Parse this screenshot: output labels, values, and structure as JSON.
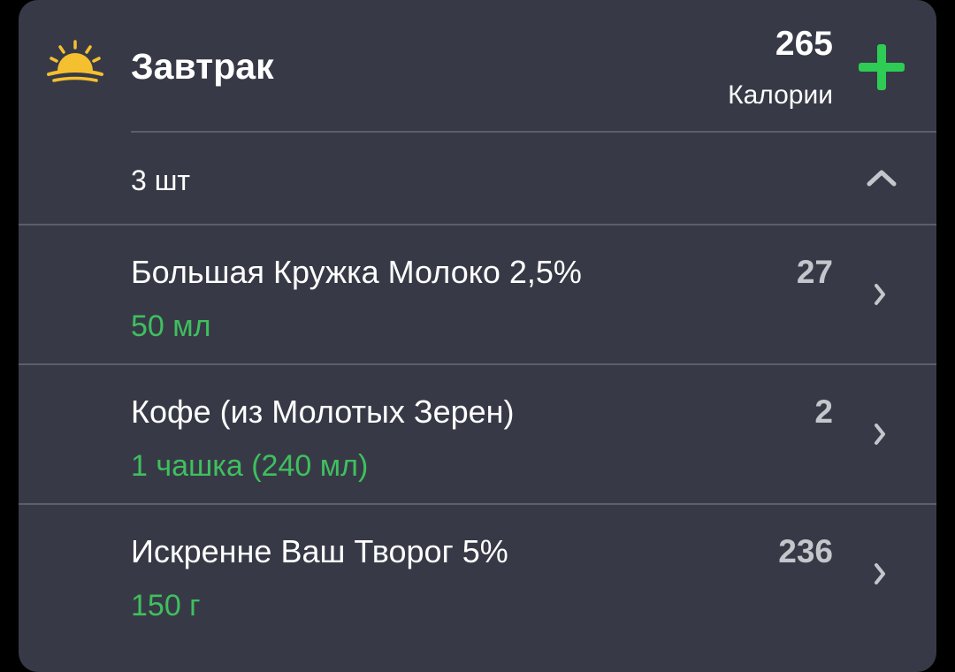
{
  "meal": {
    "title": "Завтрак",
    "icon": "sunrise-icon",
    "calories_value": "265",
    "calories_label": "Калории",
    "add_icon": "plus-icon"
  },
  "items_summary": {
    "count_label": "3 шт",
    "toggle_icon": "chevron-up-icon"
  },
  "foods": [
    {
      "name": "Большая Кружка Молоко 2,5%",
      "portion": "50 мл",
      "calories": "27"
    },
    {
      "name": "Кофе (из Молотых Зерен)",
      "portion": "1 чашка (240 мл)",
      "calories": "2"
    },
    {
      "name": "Искренне Ваш Творог 5%",
      "portion": "150 г",
      "calories": "236"
    }
  ],
  "colors": {
    "card_background": "#373a46",
    "accent_green": "#2ecc54",
    "portion_green": "#3fbf5f",
    "sun_yellow": "#f5c030"
  }
}
